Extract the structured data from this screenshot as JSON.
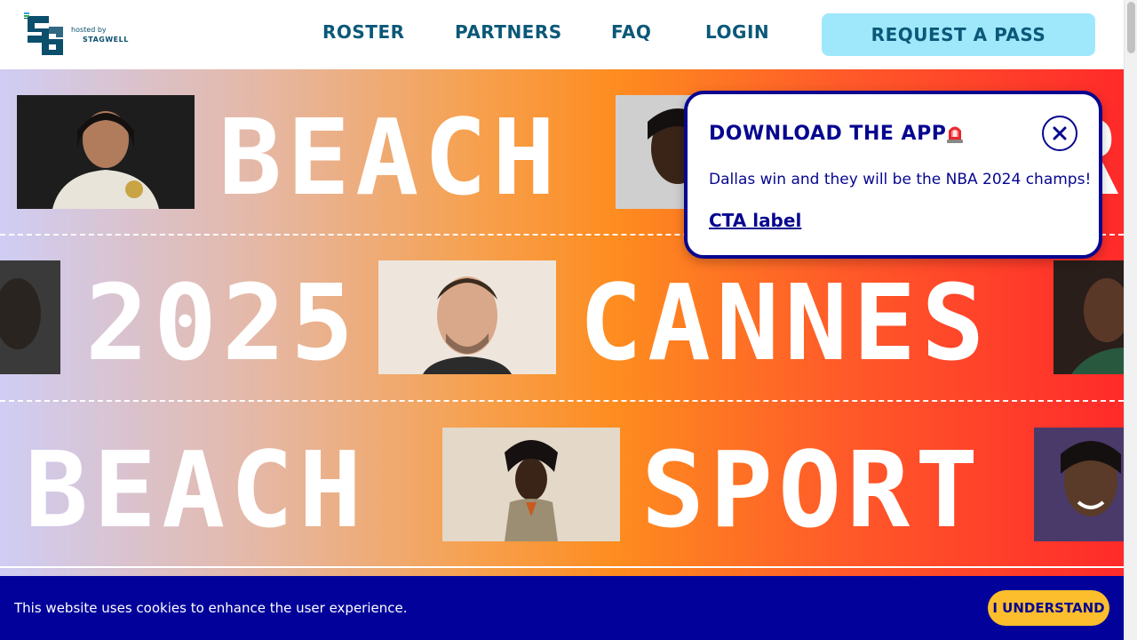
{
  "header": {
    "logo_mark": "SB",
    "hosted_by": "hosted by",
    "host_brand": "STAGWELL",
    "nav": [
      "ROSTER",
      "PARTNERS",
      "FAQ",
      "LOGIN"
    ],
    "cta": "REQUEST A PASS"
  },
  "hero": {
    "row1": [
      "BEACH"
    ],
    "row2": [
      "2025",
      "CANNES"
    ],
    "row3": [
      "BEACH",
      "SPORT"
    ]
  },
  "popup": {
    "title": "DOWNLOAD THE APP",
    "icon": "siren-icon",
    "message": "Dallas win and they will be the NBA 2024 champs!",
    "cta": "CTA label",
    "close_icon": "close-icon"
  },
  "cookie": {
    "text": "This website uses cookies to enhance the user experience.",
    "button": "I UNDERSTAND"
  },
  "colors": {
    "navy": "#06068f",
    "teal": "#0b5878",
    "cta_bg": "#9fe8fb",
    "cookie_bg": "#02029a",
    "cookie_btn": "#fcbe2d"
  }
}
